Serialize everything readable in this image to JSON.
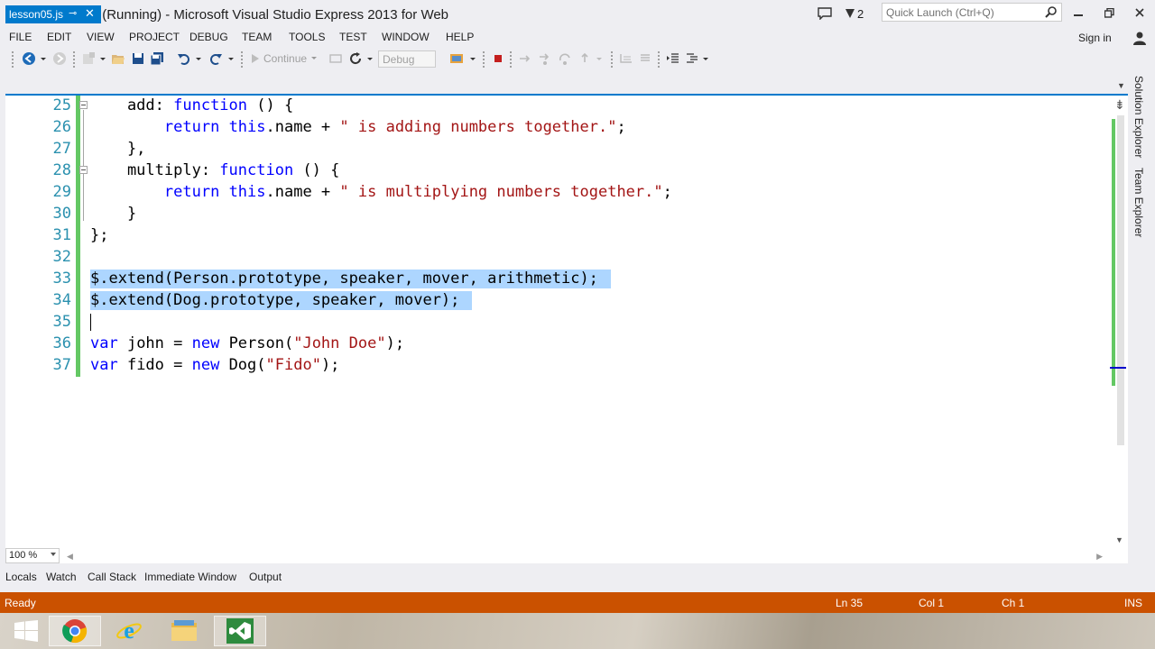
{
  "window": {
    "title": "Lesson05 (Running) - Microsoft Visual Studio Express 2013 for Web",
    "notification_count": "2",
    "quick_launch_placeholder": "Quick Launch (Ctrl+Q)"
  },
  "menu": {
    "items": [
      "FILE",
      "EDIT",
      "VIEW",
      "PROJECT",
      "DEBUG",
      "TEAM",
      "TOOLS",
      "TEST",
      "WINDOW",
      "HELP"
    ],
    "sign_in": "Sign in"
  },
  "toolbar": {
    "continue_label": "Continue",
    "configuration": "Debug"
  },
  "editor": {
    "tab_name": "lesson05.js",
    "zoom": "100 %",
    "lines": [
      {
        "num": "25",
        "text": "    add: function () {"
      },
      {
        "num": "26",
        "text": "        return this.name + \" is adding numbers together.\";"
      },
      {
        "num": "27",
        "text": "    },"
      },
      {
        "num": "28",
        "text": "    multiply: function () {"
      },
      {
        "num": "29",
        "text": "        return this.name + \" is multiplying numbers together.\";"
      },
      {
        "num": "30",
        "text": "    }"
      },
      {
        "num": "31",
        "text": "};"
      },
      {
        "num": "32",
        "text": ""
      },
      {
        "num": "33",
        "text": "$.extend(Person.prototype, speaker, mover, arithmetic);"
      },
      {
        "num": "34",
        "text": "$.extend(Dog.prototype, speaker, mover);"
      },
      {
        "num": "35",
        "text": ""
      },
      {
        "num": "36",
        "text": "var john = new Person(\"John Doe\");"
      },
      {
        "num": "37",
        "text": "var fido = new Dog(\"Fido\");"
      }
    ]
  },
  "side_panels": [
    "Solution Explorer",
    "Team Explorer"
  ],
  "bottom_tabs": [
    "Locals",
    "Watch",
    "Call Stack",
    "Immediate Window",
    "Output"
  ],
  "status": {
    "state": "Ready",
    "line": "Ln 35",
    "col": "Col 1",
    "ch": "Ch 1",
    "mode": "INS"
  },
  "colors": {
    "status_bar": "#ca5100",
    "accent": "#007acc",
    "keyword": "#0000ff",
    "string": "#a31515",
    "line_number": "#2b91af",
    "selection": "#add6ff"
  },
  "taskbar": {
    "apps": [
      "windows-start-icon",
      "chrome-icon",
      "internet-explorer-icon",
      "file-explorer-icon",
      "visual-studio-icon"
    ]
  }
}
